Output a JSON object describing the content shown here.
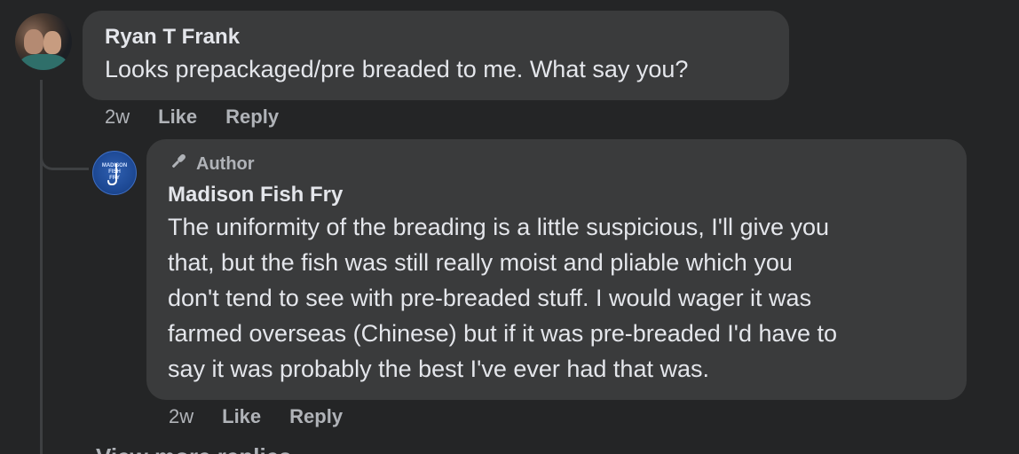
{
  "comments": [
    {
      "author": "Ryan T Frank",
      "text": "Looks prepackaged/pre breaded to me. What say you?",
      "time": "2w",
      "like_label": "Like",
      "reply_label": "Reply"
    },
    {
      "badge": "Author",
      "badge_icon": "microphone-icon",
      "author": "Madison Fish Fry",
      "text_lines": [
        "The uniformity of the breading is a little suspicious, I'll give you",
        "that, but the fish was still really moist and pliable which you",
        "don't tend to see with pre-breaded stuff. I would wager it was",
        "farmed overseas (Chinese) but if it was pre-breaded I'd have to",
        "say it was probably the best I've ever had that was."
      ],
      "time": "2w",
      "like_label": "Like",
      "reply_label": "Reply",
      "avatar_text": "MADISON FISH FRY"
    }
  ],
  "view_more_label": "View more replies",
  "colors": {
    "background": "#242526",
    "bubble": "#3a3b3c",
    "primary_text": "#e4e6eb",
    "secondary_text": "#b0b3b8"
  }
}
